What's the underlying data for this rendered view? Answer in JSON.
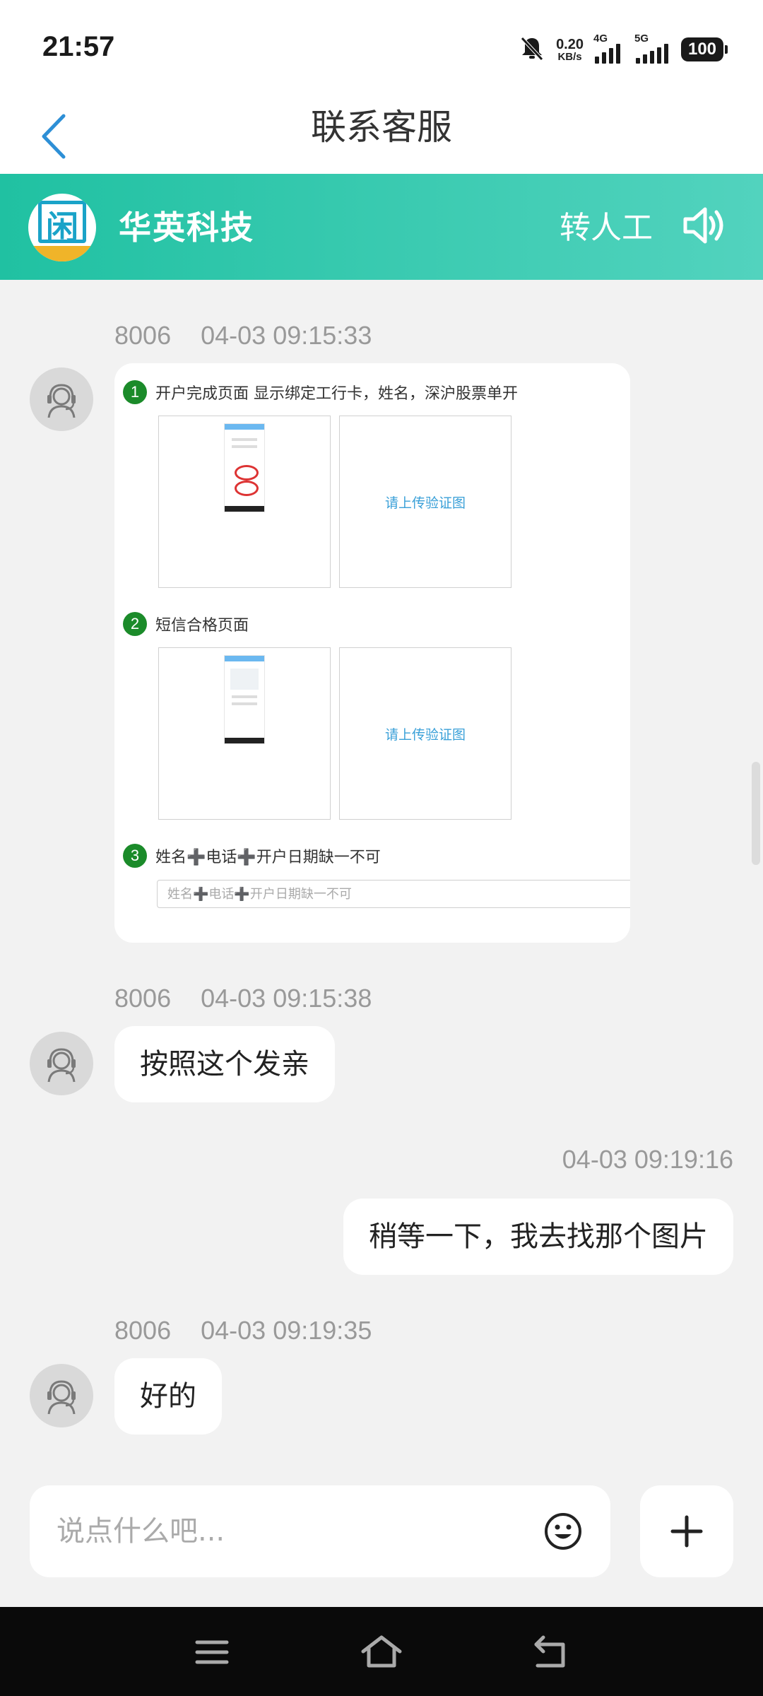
{
  "status_bar": {
    "time": "21:57",
    "net_speed_value": "0.20",
    "net_speed_unit": "KB/s",
    "sim1_label": "4G",
    "sim2_label": "5G",
    "battery": "100"
  },
  "header": {
    "title": "联系客服"
  },
  "brand": {
    "logo_char": "闲",
    "name": "华英科技",
    "transfer_label": "转人工"
  },
  "messages": [
    {
      "sender": "8006",
      "time": "04-03 09:15:33",
      "type": "image",
      "image": {
        "step1_num": "1",
        "step1_text": "开户完成页面 显示绑定工行卡，姓名，深沪股票单开",
        "step1_upload": "请上传验证图",
        "step2_num": "2",
        "step2_text": "短信合格页面",
        "step2_upload": "请上传验证图",
        "step3_num": "3",
        "step3_text": "姓名➕电话➕开户日期缺一不可",
        "step3_input_placeholder": "姓名➕电话➕开户日期缺一不可"
      }
    },
    {
      "sender": "8006",
      "time": "04-03 09:15:38",
      "type": "text",
      "text": "按照这个发亲"
    },
    {
      "sender": "",
      "time": "04-03 09:19:16",
      "type": "text",
      "text": "稍等一下，我去找那个图片"
    },
    {
      "sender": "8006",
      "time": "04-03 09:19:35",
      "type": "text",
      "text": "好的"
    }
  ],
  "composer": {
    "placeholder": "说点什么吧..."
  },
  "colors": {
    "brand_gradient_start": "#20c1a2",
    "brand_gradient_end": "#52d3be",
    "back_arrow": "#2d8fd6",
    "step_badge": "#1b8b2a",
    "upload_text": "#3aa0d8"
  },
  "icons": {
    "back": "chevron-left-icon",
    "mute": "bell-off-icon",
    "speaker": "speaker-icon",
    "agent_avatar": "headset-agent-icon",
    "emoji": "smiley-icon",
    "plus": "plus-icon",
    "sys_menu": "menu-icon",
    "sys_home": "home-icon",
    "sys_back": "back-icon"
  }
}
